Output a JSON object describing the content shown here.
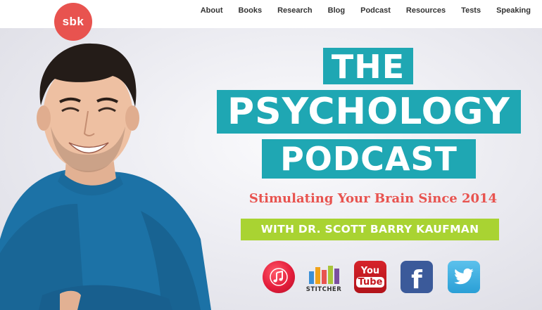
{
  "brand": {
    "logo_text": "sbk"
  },
  "nav": {
    "items": [
      {
        "label": "About"
      },
      {
        "label": "Books"
      },
      {
        "label": "Research"
      },
      {
        "label": "Blog"
      },
      {
        "label": "Podcast"
      },
      {
        "label": "Resources"
      },
      {
        "label": "Tests"
      },
      {
        "label": "Speaking"
      }
    ]
  },
  "hero": {
    "title_line1": "THE",
    "title_line2": "PSYCHOLOGY",
    "title_line3": "PODCAST",
    "tagline": "Stimulating Your Brain Since 2014",
    "host_banner": "WITH DR. SCOTT BARRY KAUFMAN"
  },
  "platforms": {
    "stitcher_label": "STITCHER",
    "youtube_you": "You",
    "youtube_tube": "Tube",
    "facebook_letter": "f"
  },
  "colors": {
    "accent_teal": "#1fa7b3",
    "tagline_red": "#e8534f",
    "banner_green": "#a9d332",
    "logo_red": "#e8534f"
  }
}
